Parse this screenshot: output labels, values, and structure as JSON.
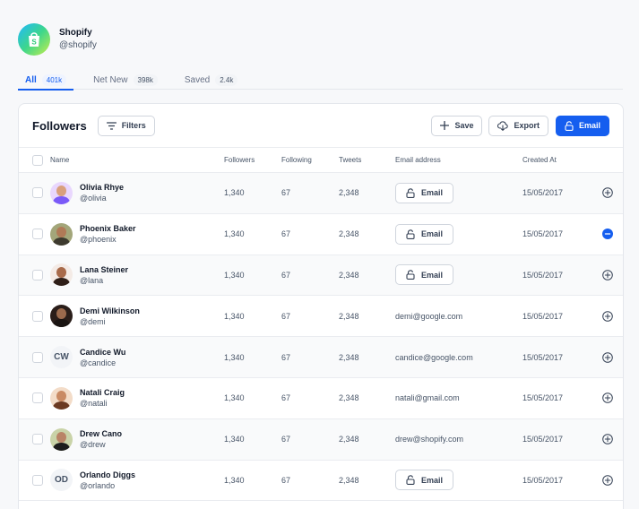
{
  "app": {
    "name": "Shopify",
    "handle": "@shopify"
  },
  "tabs": [
    {
      "label": "All",
      "count": "401k",
      "active": true
    },
    {
      "label": "Net New",
      "count": "398k",
      "active": false
    },
    {
      "label": "Saved",
      "count": "2.4k",
      "active": false
    }
  ],
  "toolbar": {
    "title": "Followers",
    "filters_label": "Filters",
    "save_label": "Save",
    "export_label": "Export",
    "email_label": "Email"
  },
  "columns": {
    "name": "Name",
    "followers": "Followers",
    "following": "Following",
    "tweets": "Tweets",
    "email": "Email address",
    "created": "Created At"
  },
  "rows": [
    {
      "name": "Olivia Rhye",
      "handle": "@olivia",
      "followers": "1,340",
      "following": "67",
      "tweets": "2,348",
      "email": "",
      "email_button": "Email",
      "created": "15/05/2017",
      "action": "add",
      "avatar_bg": "#e9d7fe",
      "skin": "#d9a07d",
      "shirt": "#7a5af8"
    },
    {
      "name": "Phoenix Baker",
      "handle": "@phoenix",
      "followers": "1,340",
      "following": "67",
      "tweets": "2,348",
      "email": "",
      "email_button": "Email",
      "created": "15/05/2017",
      "action": "remove",
      "avatar_bg": "#a3a67a",
      "skin": "#b07a57",
      "shirt": "#3d3a2e"
    },
    {
      "name": "Lana Steiner",
      "handle": "@lana",
      "followers": "1,340",
      "following": "67",
      "tweets": "2,348",
      "email": "",
      "email_button": "Email",
      "created": "15/05/2017",
      "action": "add",
      "avatar_bg": "#f4ebe6",
      "skin": "#a86a4a",
      "shirt": "#2f1f18"
    },
    {
      "name": "Demi Wilkinson",
      "handle": "@demi",
      "followers": "1,340",
      "following": "67",
      "tweets": "2,348",
      "email": "demi@google.com",
      "email_button": "",
      "created": "15/05/2017",
      "action": "add",
      "avatar_bg": "#2a1e1a",
      "skin": "#9b6a4d",
      "shirt": "#1a1412"
    },
    {
      "name": "Candice Wu",
      "handle": "@candice",
      "initials": "CW",
      "followers": "1,340",
      "following": "67",
      "tweets": "2,348",
      "email": "candice@google.com",
      "email_button": "",
      "created": "15/05/2017",
      "action": "add"
    },
    {
      "name": "Natali Craig",
      "handle": "@natali",
      "followers": "1,340",
      "following": "67",
      "tweets": "2,348",
      "email": "natali@gmail.com",
      "email_button": "",
      "created": "15/05/2017",
      "action": "add",
      "avatar_bg": "#f3dcc8",
      "skin": "#c98a63",
      "shirt": "#6b3a22"
    },
    {
      "name": "Drew Cano",
      "handle": "@drew",
      "followers": "1,340",
      "following": "67",
      "tweets": "2,348",
      "email": "drew@shopify.com",
      "email_button": "",
      "created": "15/05/2017",
      "action": "add",
      "avatar_bg": "#c9d3a8",
      "skin": "#b98466",
      "shirt": "#1d1d1d"
    },
    {
      "name": "Orlando Diggs",
      "handle": "@orlando",
      "initials": "OD",
      "followers": "1,340",
      "following": "67",
      "tweets": "2,348",
      "email": "",
      "email_button": "Email",
      "created": "15/05/2017",
      "action": "add"
    }
  ],
  "colors": {
    "accent": "#155eef",
    "border": "#d0d5dd",
    "muted_text": "#475467"
  }
}
